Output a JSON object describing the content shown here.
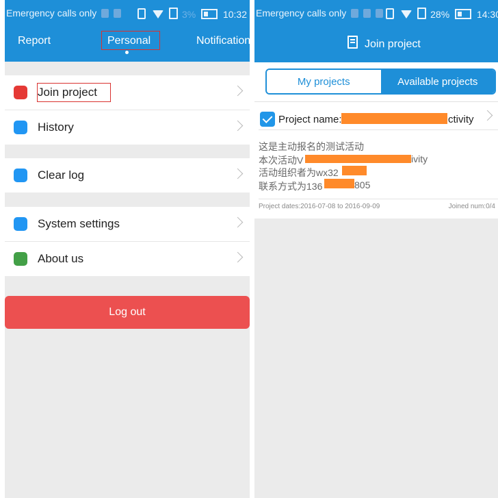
{
  "left": {
    "status": {
      "left_text": "Emergency calls only",
      "battery_text": "3%",
      "time": "10:32"
    },
    "tabs": [
      "Report",
      "Personal",
      "Notification"
    ],
    "menu": {
      "group1": [
        {
          "label": "Join project",
          "icon": "chart-icon",
          "color": "#e53935"
        },
        {
          "label": "History",
          "icon": "clipboard-icon",
          "color": "#2196f3"
        }
      ],
      "group2": [
        {
          "label": "Clear log",
          "icon": "trash-icon",
          "color": "#2196f3"
        }
      ],
      "group3": [
        {
          "label": "System settings",
          "icon": "settings-icon",
          "color": "#2196f3"
        },
        {
          "label": "About us",
          "icon": "info-icon",
          "color": "#43a047"
        }
      ]
    },
    "logout_label": "Log out"
  },
  "right": {
    "status": {
      "left_text": "Emergency calls only",
      "battery_text": "28%",
      "time": "14:30"
    },
    "title": "Join project",
    "segments": [
      "My projects",
      "Available projects"
    ],
    "project": {
      "name_label": "Project name:",
      "name_tail": "ctivity",
      "desc1": "这是主动报名的测试活动",
      "desc2_prefix": "本次活动V",
      "desc2_tail": "ivity",
      "desc3_prefix": "活动组织者为wx32",
      "desc4_prefix": "联系方式为136",
      "desc4_tail": "805",
      "dates": "Project dates:2016-07-08 to 2016-09-09",
      "joined": "Joined num:0/4"
    }
  },
  "colors": {
    "primary": "#1e8fd8",
    "logout": "#ec5050",
    "redaction": "#ff8a2a",
    "highlight_box": "#d9312f"
  }
}
